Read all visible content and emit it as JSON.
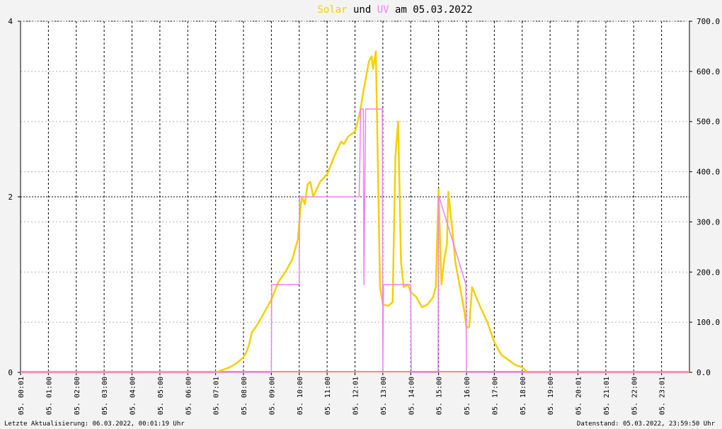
{
  "title": {
    "w1": "Solar",
    "w2": " und ",
    "w3": "UV",
    "w4": " am 05.03.2022"
  },
  "footer": {
    "left": "Letzte Aktualisierung: 06.03.2022, 00:01:19 Uhr",
    "right": "Datenstand: 05.03.2022, 23:59:50 Uhr"
  },
  "chart_data": {
    "type": "line",
    "title": "Solar und UV am 05.03.2022",
    "xlabel": "",
    "ylabel": "",
    "xlim": [
      0,
      24
    ],
    "ylim_left": [
      0,
      4
    ],
    "ylim_right": [
      0,
      700
    ],
    "left_ticks": [
      "0",
      "2",
      "4"
    ],
    "right_ticks": [
      "0.0",
      "100.0",
      "200.0",
      "300.0",
      "400.0",
      "500.0",
      "600.0",
      "700.0"
    ],
    "x_tick_labels": [
      "05. 00:01",
      "05. 01:00",
      "05. 02:00",
      "05. 03:00",
      "05. 04:00",
      "05. 05:00",
      "05. 06:00",
      "05. 07:01",
      "05. 08:00",
      "05. 09:00",
      "05. 10:00",
      "05. 11:00",
      "05. 12:01",
      "05. 13:00",
      "05. 14:00",
      "05. 15:00",
      "05. 16:00",
      "05. 17:00",
      "05. 18:00",
      "05. 19:00",
      "05. 20:01",
      "05. 21:01",
      "05. 22:00",
      "05. 23:01"
    ],
    "x_tick_hours": [
      0,
      1,
      2,
      3,
      4,
      5,
      6,
      7,
      8,
      9,
      10,
      11,
      12,
      13,
      14,
      15,
      16,
      17,
      18,
      19,
      20,
      21,
      22,
      23
    ],
    "grid": true,
    "colors": {
      "solar": "#f5d000",
      "uv": "#ee82ee",
      "zero_line": "#ff8c69",
      "background": "#ffffff",
      "grid": "#000000"
    },
    "series": [
      {
        "name": "Solar",
        "axis": "right",
        "x": [
          0,
          7.0,
          7.25,
          7.5,
          7.75,
          8.0,
          8.1,
          8.2,
          8.3,
          8.5,
          8.75,
          9.0,
          9.25,
          9.5,
          9.75,
          9.95,
          10.05,
          10.1,
          10.2,
          10.3,
          10.4,
          10.5,
          10.75,
          11.0,
          11.25,
          11.5,
          11.6,
          11.75,
          12.0,
          12.1,
          12.2,
          12.3,
          12.4,
          12.5,
          12.6,
          12.65,
          12.75,
          12.9,
          13.0,
          13.2,
          13.35,
          13.45,
          13.55,
          13.65,
          13.75,
          13.9,
          14.0,
          14.2,
          14.4,
          14.6,
          14.8,
          14.9,
          15.0,
          15.1,
          15.2,
          15.3,
          15.35,
          15.5,
          15.6,
          15.75,
          15.9,
          16.0,
          16.1,
          16.2,
          16.35,
          16.5,
          16.75,
          17.0,
          17.25,
          17.5,
          17.75,
          18.0,
          18.1,
          18.2,
          24
        ],
        "y": [
          0,
          0,
          5,
          10,
          18,
          30,
          40,
          55,
          80,
          95,
          120,
          145,
          180,
          200,
          225,
          265,
          330,
          350,
          335,
          375,
          380,
          350,
          380,
          395,
          430,
          460,
          455,
          470,
          480,
          500,
          525,
          560,
          590,
          620,
          630,
          605,
          640,
          170,
          135,
          133,
          140,
          430,
          500,
          220,
          170,
          175,
          160,
          150,
          130,
          135,
          150,
          170,
          365,
          175,
          225,
          255,
          360,
          280,
          220,
          175,
          130,
          90,
          90,
          170,
          150,
          130,
          100,
          60,
          35,
          25,
          15,
          10,
          5,
          0,
          0
        ]
      },
      {
        "name": "UV",
        "axis": "left",
        "x": [
          0,
          9.0,
          9.01,
          10.0,
          10.01,
          12.15,
          12.18,
          12.2,
          12.3,
          12.32,
          12.38,
          12.4,
          12.98,
          13.0,
          13.02,
          14.0,
          14.02,
          14.98,
          15.0,
          15.02,
          15.98,
          16.0,
          16.02,
          24
        ],
        "y": [
          0,
          0,
          1,
          1,
          2,
          2,
          2.5,
          3,
          3,
          1,
          3,
          3,
          3,
          0,
          1,
          1,
          0,
          0,
          2,
          2,
          1,
          0,
          0,
          0
        ]
      }
    ]
  }
}
